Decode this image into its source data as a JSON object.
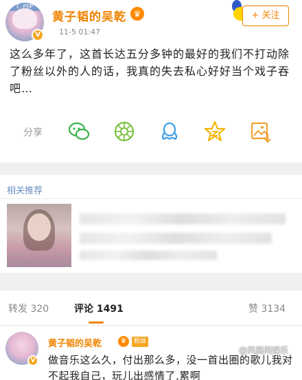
{
  "post": {
    "avatar_tag": "C-POP",
    "author": "黄子韬的吴乾",
    "time": "11-5 01:47",
    "follow_label": "+ 关注",
    "text": "这么多年了，这首长达五分多钟的最好的我们不打动除了粉丝以外的人的话，我真的失去私心好好当个戏子吞吧…",
    "share_label": "分享",
    "share_icons": [
      "wechat-icon",
      "moments-icon",
      "qq-icon",
      "qzone-icon",
      "save-image-icon"
    ]
  },
  "recommend": {
    "title": "相关推荐"
  },
  "tabs": {
    "repost_label": "转发 320",
    "comment_label": "评论 1491",
    "like_label": "赞 3134"
  },
  "comment": {
    "author": "黄子韬的吴乾",
    "level": "粉丝",
    "text": "做音乐这么久，付出那么多，没一首出圈的歌儿我对不起我自己，玩儿出感情了,累啊"
  },
  "watermark": "@凤凰网娱乐",
  "colors": {
    "accent": "#f08300",
    "wechat": "#3bb34a",
    "moments": "#7cc242",
    "qq": "#3d9ee8",
    "qzone": "#f5b400",
    "save": "#f0a030"
  }
}
